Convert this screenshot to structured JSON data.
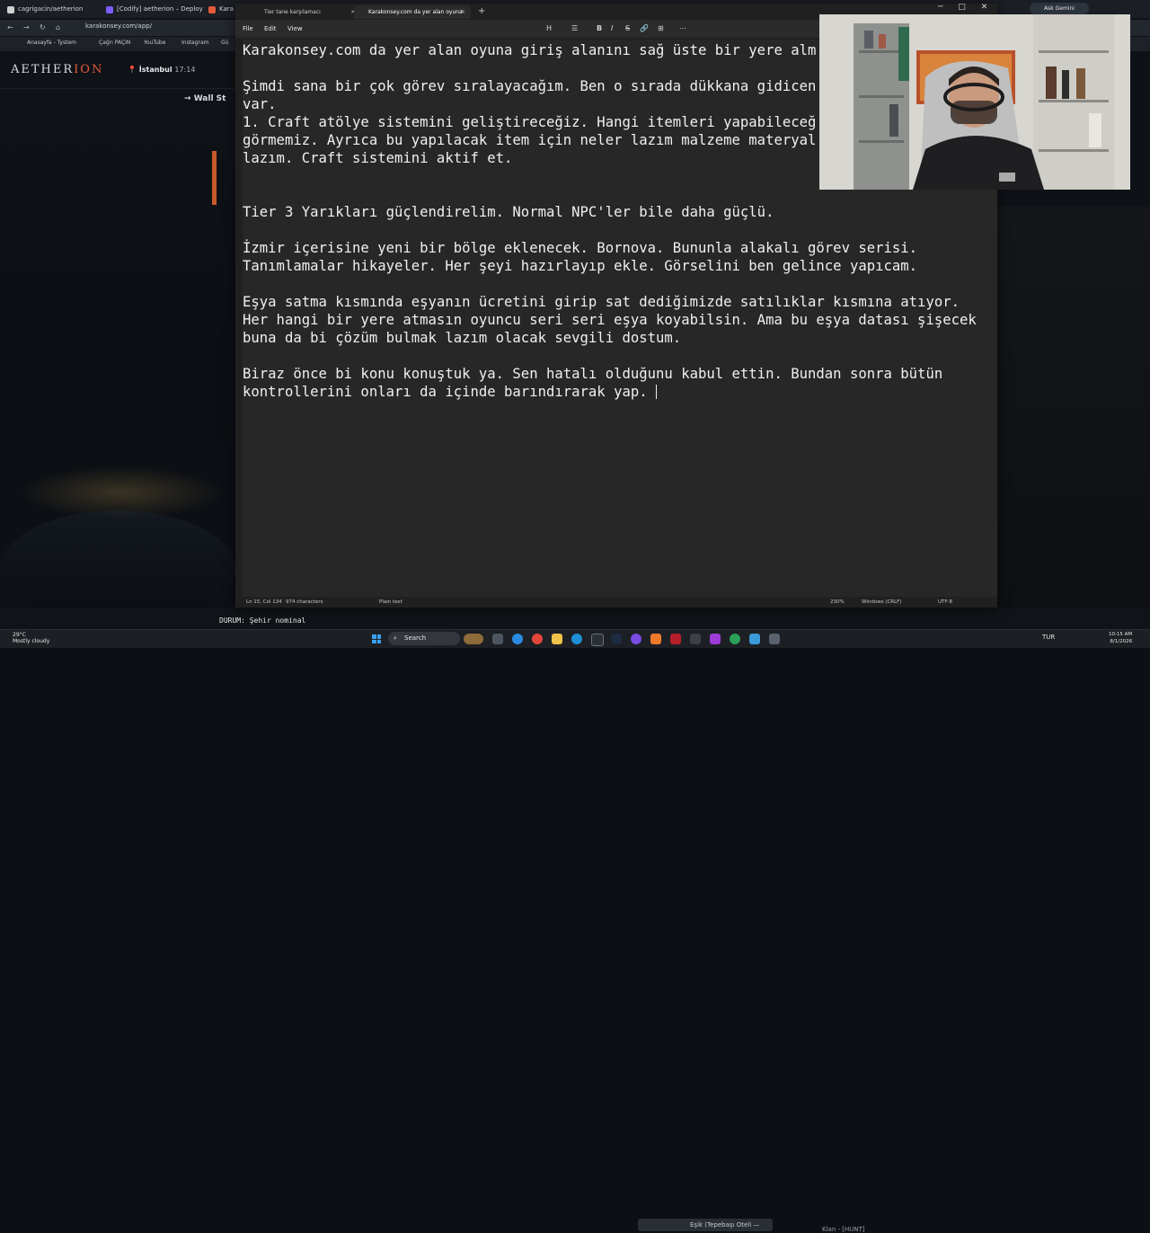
{
  "browser": {
    "tabs": [
      {
        "title": "cagrigacin/aetherion"
      },
      {
        "title": "[Codify] aetherion – Deploy"
      },
      {
        "title": "Kara K"
      }
    ],
    "url": "karakonsey.com/app/",
    "bookmarks": [
      "Anasayfa - Tystem",
      "Çağrı PAÇIN",
      "YouTube",
      "Instagram",
      "Gü"
    ],
    "extension_button": "Ask Gemini"
  },
  "site": {
    "logo_main": "AETHER",
    "logo_accent": "ION",
    "city": "İstanbul",
    "time": "17:14",
    "ticker": "Wall St",
    "durum": "DURUM: Şehir nominal",
    "strip_label": "Eşik (Tepebaşı Oteli —",
    "strip_right": "Klan - [HUNT]"
  },
  "notepad": {
    "tabs": [
      {
        "title": "Tier tane karşılamacı",
        "close": "×"
      },
      {
        "title": "Karakonsey.com da yer alan oyuna",
        "close": "×"
      }
    ],
    "new_tab": "+",
    "menu": [
      "File",
      "Edit",
      "View"
    ],
    "toolbar": {
      "heading": "H",
      "bold": "B",
      "italic": "I",
      "strike": "S",
      "link": "🔗",
      "list": "☰",
      "table": "⊞",
      "more": "⋯"
    },
    "window_controls": {
      "minimize": "─",
      "maximize": "□",
      "close": "✕"
    },
    "lines": [
      {
        "text": "Karakonsey.com da yer alan oyuna giriş alanını sağ üste bir yere alm"
      },
      {
        "text": ""
      },
      {
        "text": "Şimdi sana bir çok görev sıralayacağım. Ben o sırada dükkana gidicen"
      },
      {
        "text": "var."
      },
      {
        "text": "1. Craft atölye sistemini geliştireceğiz. Hangi itemleri yapabileceğ"
      },
      {
        "text": "görmemiz. Ayrıca bu yapılacak item için neler lazım malzeme materyal"
      },
      {
        "text": "lazım. Craft sistemini aktif et."
      },
      {
        "text": ""
      },
      {
        "text": ""
      },
      {
        "text": "Tier 3 Yarıkları güçlendirelim. Normal NPC'ler bile daha güçlü."
      },
      {
        "text": ""
      },
      {
        "text": "İzmir içerisine yeni bir bölge eklenecek. Bornova. Bununla alakalı görev serisi."
      },
      {
        "text": "Tanımlamalar hikayeler. Her şeyi hazırlayıp ekle. Görselini ben gelince yapıcam."
      },
      {
        "text": ""
      },
      {
        "text": "Eşya satma kısmında eşyanın ücretini girip sat dediğimizde satılıklar kısmına atıyor."
      },
      {
        "text": "Her hangi bir yere atmasın oyuncu seri seri eşya koyabilsin. Ama bu eşya datası şişecek"
      },
      {
        "text": "buna da bi çözüm bulmak lazım olacak sevgili dostum."
      },
      {
        "text": ""
      },
      {
        "text": "Biraz önce bi konu konuştuk ya. Sen hatalı olduğunu kabul ettin. Bundan sonra bütün"
      },
      {
        "text": "kontrollerini onları da içinde barındırarak yap. "
      }
    ],
    "status": {
      "position": "Ln 15, Col 134",
      "characters": "974 characters",
      "format": "Plain text",
      "zoom": "230%",
      "line_ending": "Windows (CRLF)",
      "encoding": "UTF-8"
    }
  },
  "taskbar": {
    "weather_temp": "29°C",
    "weather_desc": "Mostly cloudy",
    "search_placeholder": "Search",
    "tray_lang": "TUR",
    "clock_time": "10:15 AM",
    "clock_date": "8/1/2026"
  },
  "colors": {
    "notepad_bg": "#272727",
    "notepad_text": "#f0f0f0",
    "spellcheck": "#e0443b",
    "brand_accent": "#e05b3a",
    "start_blue": "#3aa0f3"
  }
}
